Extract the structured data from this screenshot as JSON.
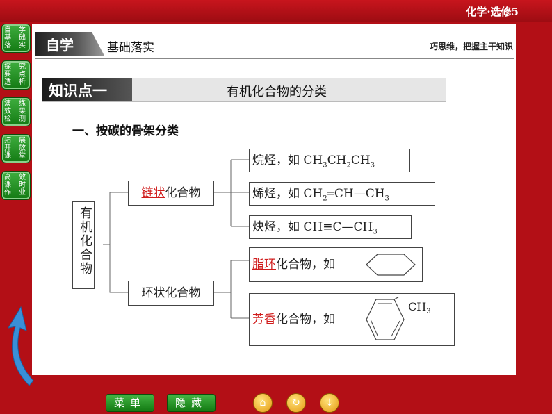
{
  "course": "化学·选修5",
  "nav": [
    {
      "chars": [
        "自",
        "学",
        "基",
        "础",
        "落",
        "实"
      ]
    },
    {
      "chars": [
        "探",
        "究",
        "要",
        "点",
        "透",
        "析"
      ]
    },
    {
      "chars": [
        "演",
        "练",
        "效",
        "果",
        "检",
        "测"
      ]
    },
    {
      "chars": [
        "拓",
        "展",
        "开",
        "放",
        "课",
        "堂"
      ]
    },
    {
      "chars": [
        "高",
        "效",
        "课",
        "时",
        "作",
        "业"
      ]
    }
  ],
  "header": {
    "tag": "自学",
    "subtitle": "基础落实",
    "motto": "巧思维，把握主干知识"
  },
  "knowledge_point": {
    "tag": "知识点一",
    "title": "有机化合物的分类"
  },
  "section_title": "一、按碳的骨架分类",
  "tree": {
    "root": "有机化合物",
    "chain": {
      "red": "链状",
      "rest": "化合物",
      "items": [
        {
          "text": "烷烃，如 CH",
          "formula": [
            "3",
            "CH",
            "2",
            "CH",
            "3"
          ]
        },
        {
          "text": "烯烃，如 CH",
          "formula": [
            "2",
            "═CH—CH",
            "3"
          ]
        },
        {
          "text": "炔烃，如 CH≡C—CH",
          "formula": [
            "3"
          ]
        }
      ]
    },
    "ring": {
      "label": "环状化合物",
      "items": [
        {
          "red": "脂环",
          "rest": "化合物，如"
        },
        {
          "red": "芳香",
          "rest": "化合物，如",
          "substituent": "CH",
          "sub": "3"
        }
      ]
    }
  },
  "bottom": {
    "menu": "菜单",
    "hide": "隐藏"
  }
}
